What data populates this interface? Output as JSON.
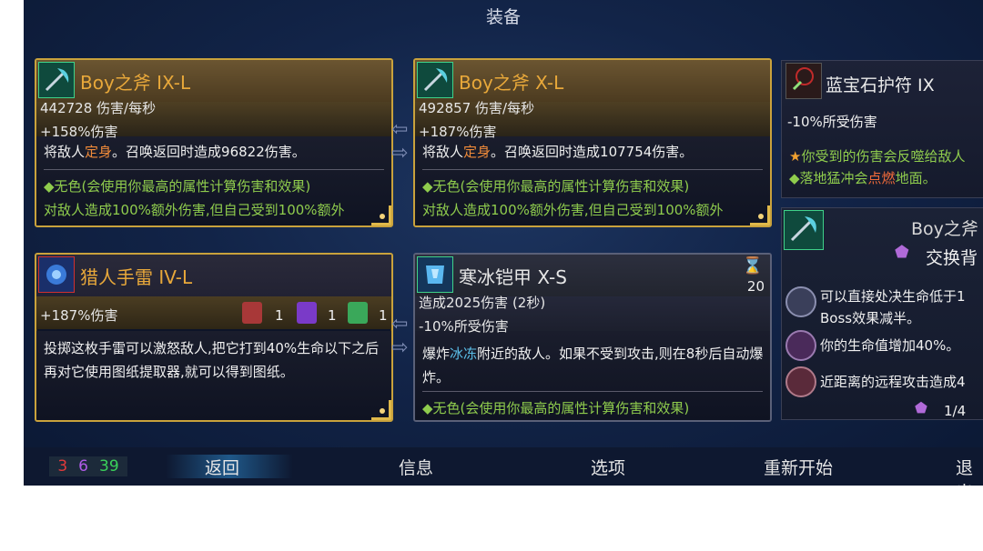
{
  "screen_title": "装备",
  "cards": {
    "axe9": {
      "name": "Boy之斧 IX-L",
      "dps": "442728 伤害/每秒",
      "bonus": "+158%伤害",
      "desc_a": "将敌人",
      "desc_hl": "定身",
      "desc_b": "。召唤返回时造成96822伤害。",
      "effect1": "◆无色(会使用你最高的属性计算伤害和效果)",
      "effect2": "对敌人造成100%额外伤害,但自己受到100%额外"
    },
    "axe10": {
      "name": "Boy之斧 X-L",
      "dps": "492857 伤害/每秒",
      "bonus": "+187%伤害",
      "desc_a": "将敌人",
      "desc_hl": "定身",
      "desc_b": "。召唤返回时造成107754伤害。",
      "effect1": "◆无色(会使用你最高的属性计算伤害和效果)",
      "effect2": "对敌人造成100%额外伤害,但自己受到100%额外"
    },
    "amulet": {
      "name": "蓝宝石护符 IX",
      "stat": "-10%所受伤害",
      "effect1_a": "你受到的伤害会反噬给敌人",
      "effect2_a": "◆落地猛冲会",
      "effect2_hl": "点燃",
      "effect2_b": "地面。"
    },
    "grenade": {
      "name": "猎人手雷 IV-L",
      "bonus": "+187%伤害",
      "scroll_counts": [
        "1",
        "1",
        "1"
      ],
      "desc": "投掷这枚手雷可以激怒敌人,把它打到40%生命以下之后再对它使用图纸提取器,就可以得到图纸。"
    },
    "armor": {
      "name": "寒冰铠甲 X-S",
      "timer": "20",
      "stat1": "造成2025伤害 (2秒)",
      "stat2": "-10%所受伤害",
      "desc_a": "爆炸",
      "desc_hl": "冰冻",
      "desc_b": "附近的敌人。如果不受到攻击,则在8秒后自动爆炸。",
      "effect1": "◆无色(会使用你最高的属性计算伤害和效果)"
    }
  },
  "right_panel": {
    "title": "Boy之斧",
    "swap": "交换背",
    "mods": [
      "可以直接处决生命低于1",
      "Boss效果减半。",
      "你的生命值增加40%。",
      "近距离的远程攻击造成4"
    ],
    "page": "1/4"
  },
  "counters": {
    "red": "3",
    "purple": "6",
    "green": "39"
  },
  "menu": {
    "back": "返回",
    "info": "信息",
    "options": "选项",
    "restart": "重新开始",
    "quit": "退出"
  },
  "colors": {
    "gold_border": "#c9a23c",
    "name_orange": "#e8a83a",
    "effect_green": "#8fcc4d"
  }
}
